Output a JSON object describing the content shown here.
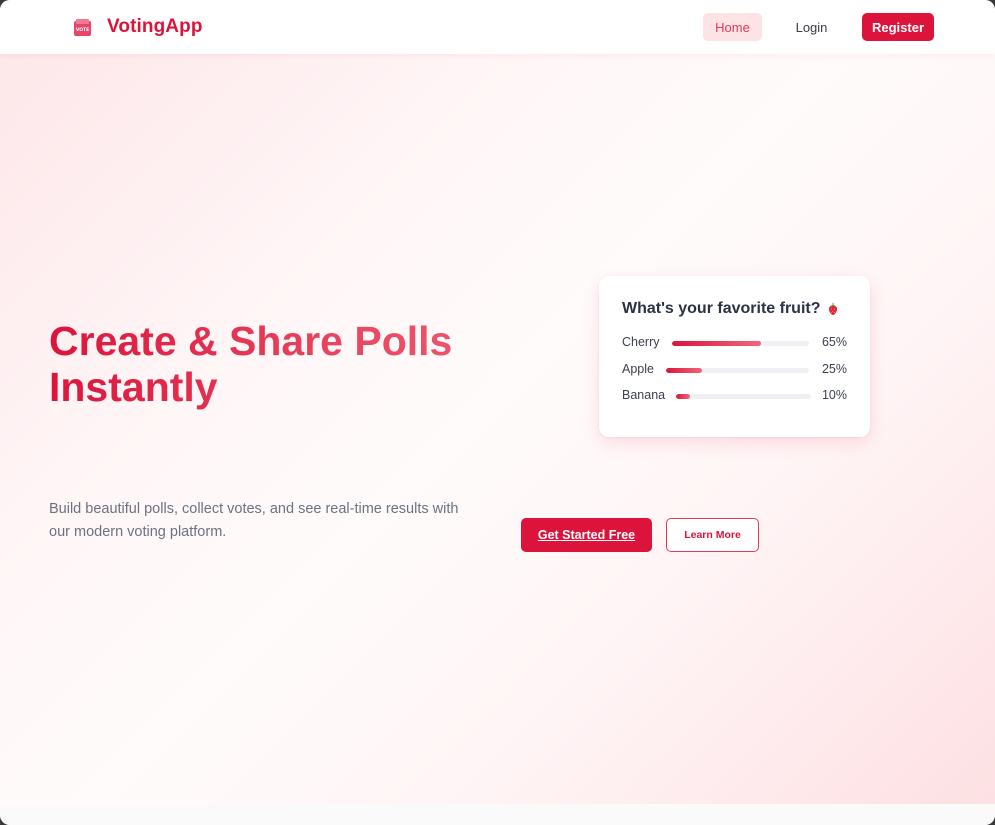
{
  "brand": {
    "name": "VotingApp",
    "icon": "ballot-box-icon",
    "icon_text": "VOTE"
  },
  "nav": {
    "home": "Home",
    "login": "Login",
    "register": "Register"
  },
  "hero": {
    "title_line1": "Create & Share Polls",
    "title_line2": "Instantly",
    "subtitle": "Build beautiful polls, collect votes, and see real-time results with our modern voting platform.",
    "cta_primary": "Get Started Free",
    "cta_secondary": "Learn More"
  },
  "poll": {
    "question": "What's your favorite fruit?",
    "icon": "strawberry-icon",
    "options": [
      {
        "label": "Cherry",
        "percent_label": "65%",
        "value": 0.65
      },
      {
        "label": "Apple",
        "percent_label": "25%",
        "value": 0.25
      },
      {
        "label": "Banana",
        "percent_label": "10%",
        "value": 0.1
      }
    ]
  },
  "colors": {
    "accent": "#dc143c",
    "accent_soft": "#fde3e6",
    "text_muted": "#6b7280"
  }
}
